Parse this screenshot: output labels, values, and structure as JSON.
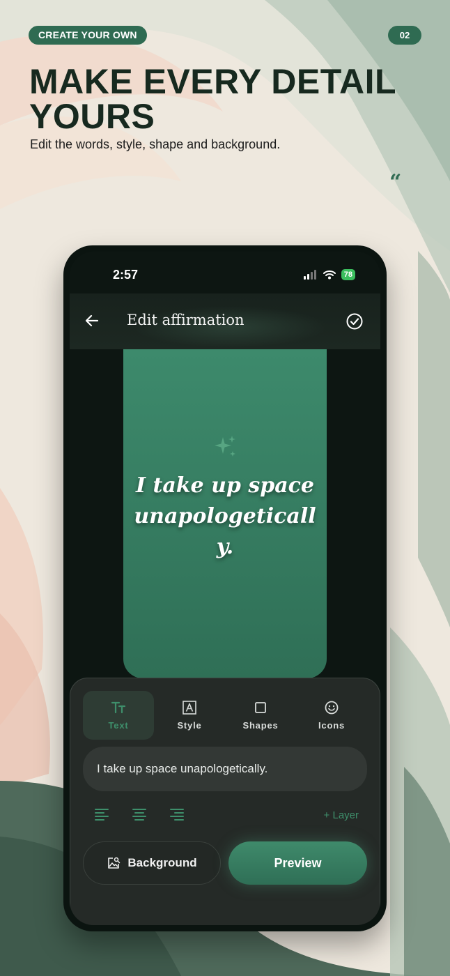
{
  "promo": {
    "badge": "CREATE YOUR OWN",
    "page_number": "02",
    "headline_line1": "MAKE EVERY DETAIL",
    "headline_line2": "YOURS",
    "subline": "Edit the words, style, shape and background.",
    "quote_mark": "“"
  },
  "status_bar": {
    "time": "2:57",
    "battery": "78"
  },
  "topbar": {
    "title": "Edit affirmation"
  },
  "card": {
    "text": "I take up space unapologetically."
  },
  "editor": {
    "tabs": [
      {
        "label": "Text",
        "icon": "text-size-icon",
        "active": true
      },
      {
        "label": "Style",
        "icon": "letter-a-box-icon",
        "active": false
      },
      {
        "label": "Shapes",
        "icon": "square-icon",
        "active": false
      },
      {
        "label": "Icons",
        "icon": "smiley-icon",
        "active": false
      }
    ],
    "text_value": "I take up space unapologetically.",
    "add_layer_label": "+ Layer",
    "background_label": "Background",
    "preview_label": "Preview"
  },
  "colors": {
    "accent": "#2f6b52",
    "card_top": "#3d8a6c",
    "card_bottom": "#2f6f56",
    "panel": "#252a27",
    "battery": "#3bbf5e"
  }
}
